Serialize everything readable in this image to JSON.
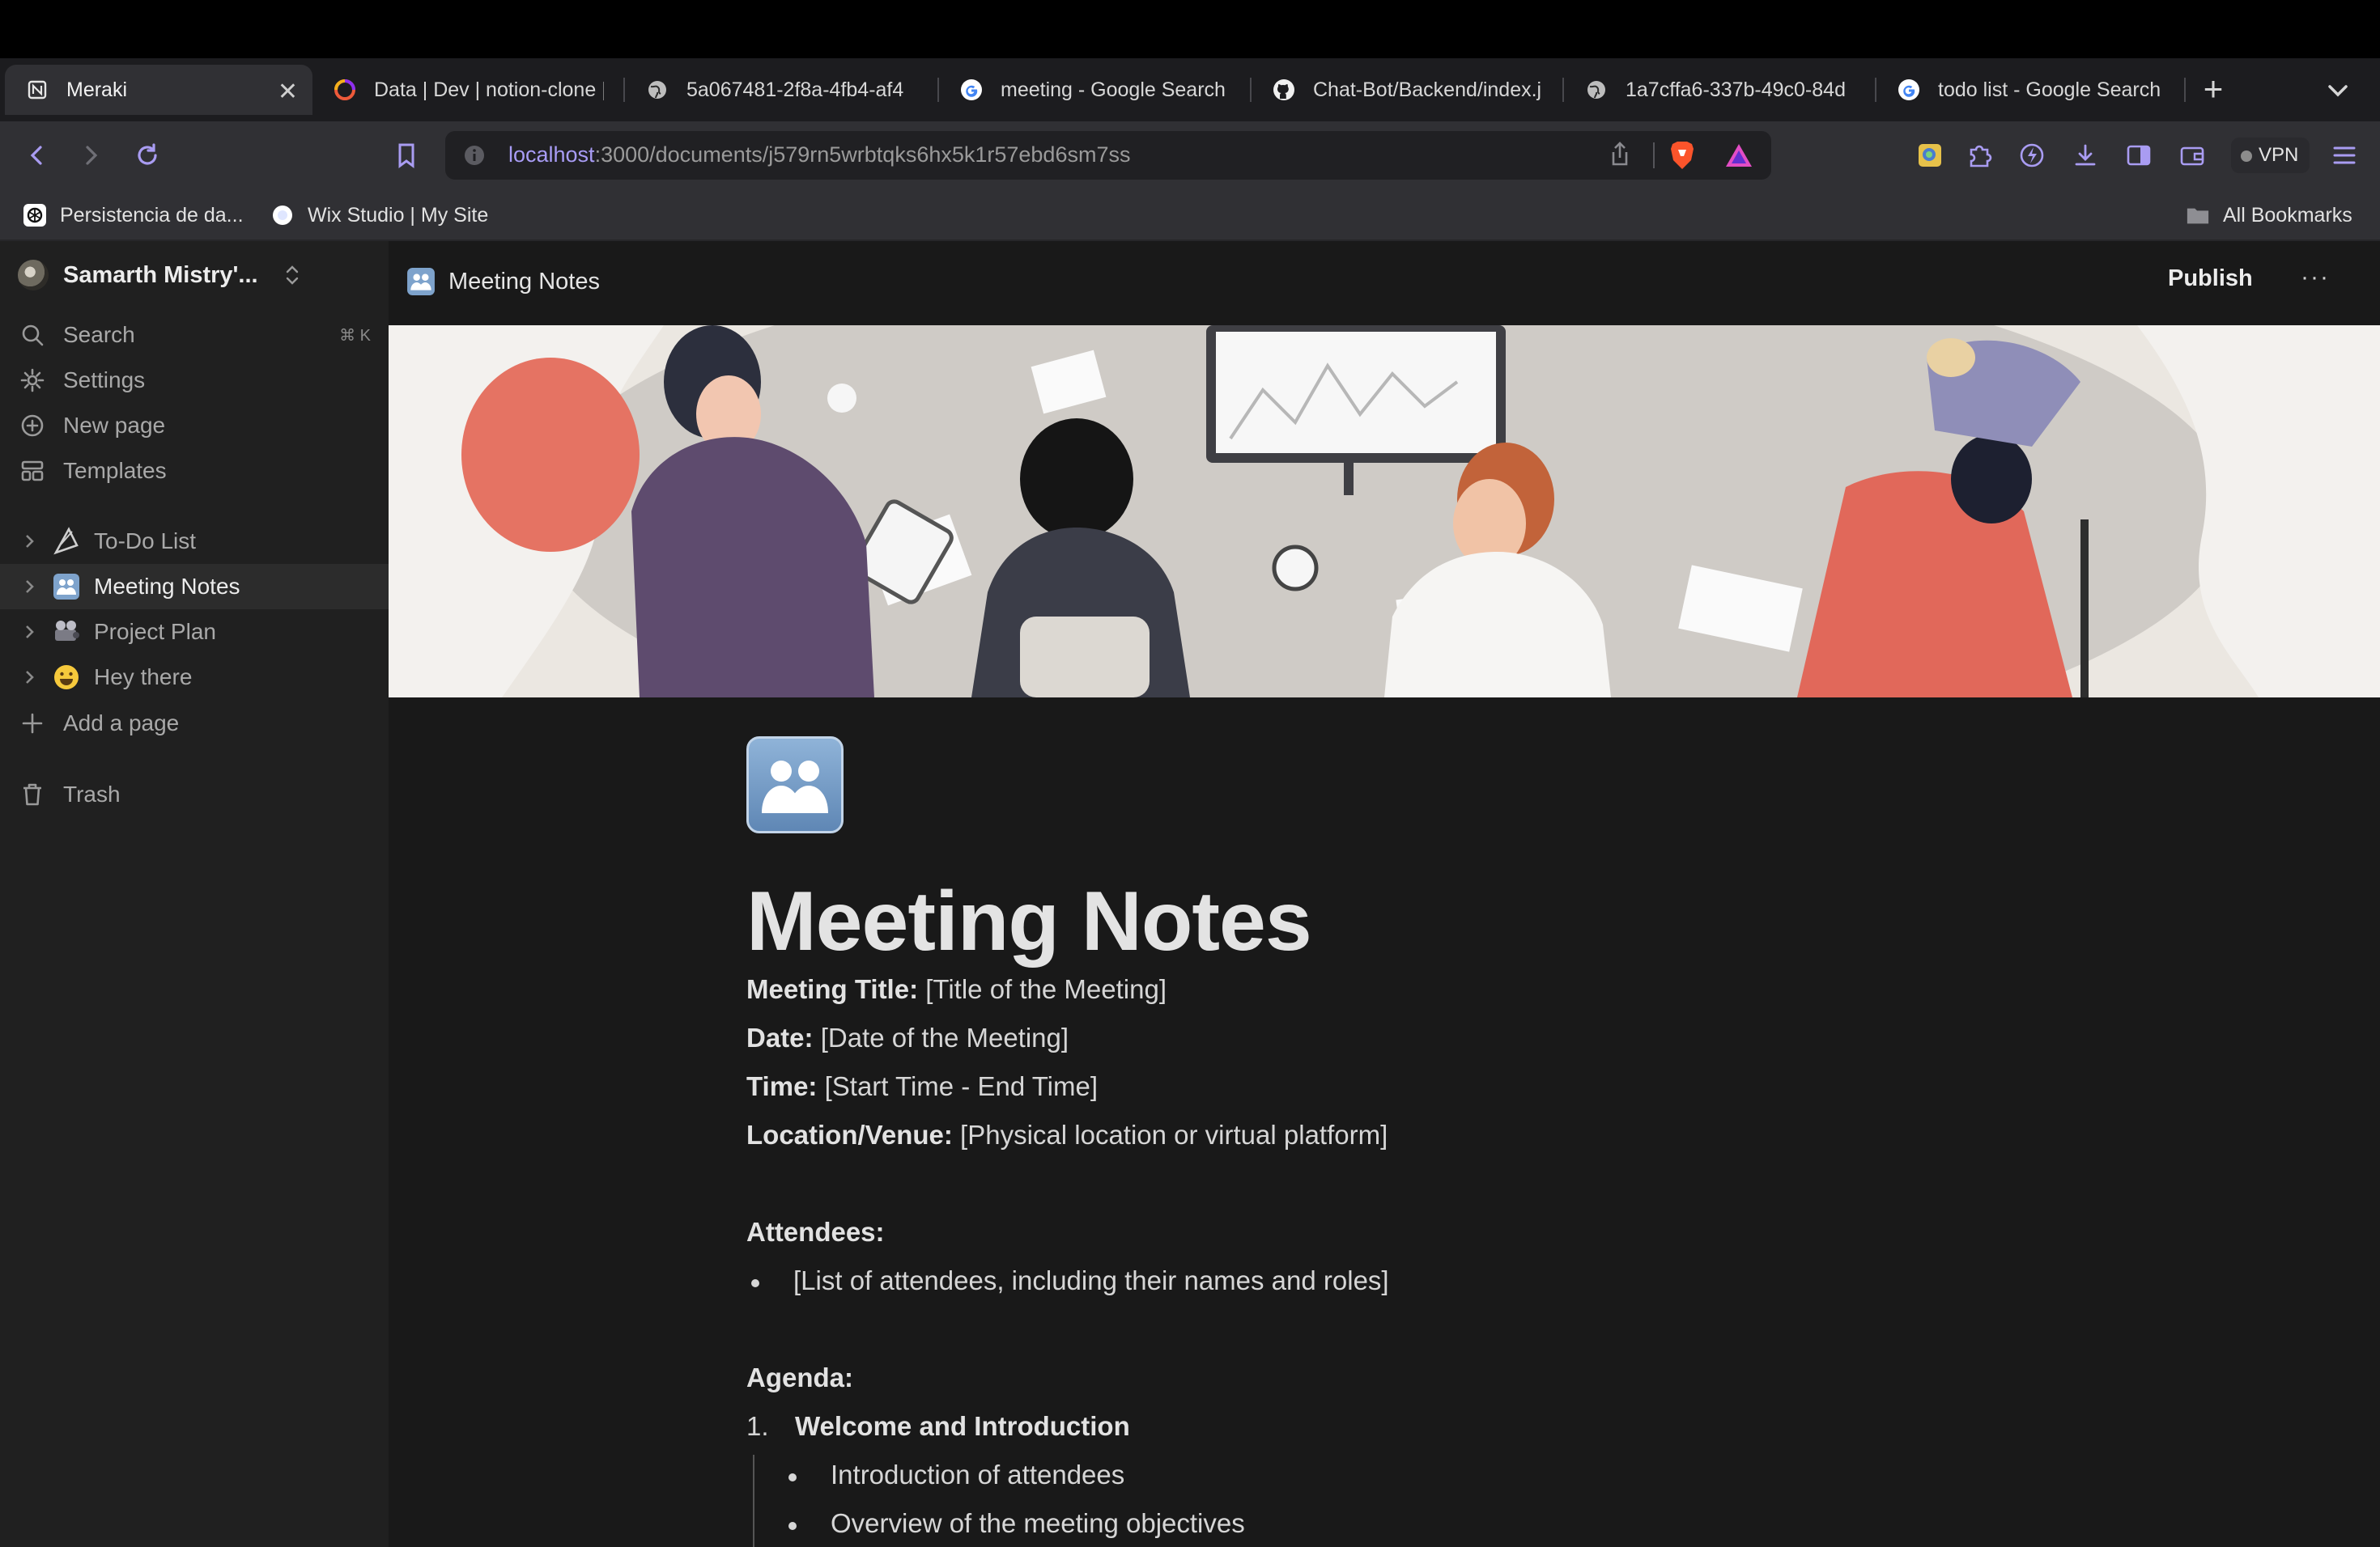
{
  "tabs": [
    {
      "title": "Meraki",
      "icon": "notion-icon",
      "active": true
    },
    {
      "title": "Data | Dev | notion-clone |",
      "icon": "convex-icon"
    },
    {
      "title": "5a067481-2f8a-4fb4-af4",
      "icon": "globe-icon"
    },
    {
      "title": "meeting - Google Search",
      "icon": "google-icon"
    },
    {
      "title": "Chat-Bot/Backend/index.j",
      "icon": "github-icon"
    },
    {
      "title": "1a7cffa6-337b-49c0-84d",
      "icon": "globe-icon"
    },
    {
      "title": "todo list - Google Search",
      "icon": "google-icon"
    }
  ],
  "tab_close": "✕",
  "new_tab": "+",
  "address": {
    "host": "localhost",
    "path": ":3000/documents/j579rn5wrbtqks6hx5k1r57ebd6sm7ss"
  },
  "vpn_label": "VPN",
  "bookmarks": {
    "items": [
      "Persistencia de da...",
      "Wix Studio | My Site"
    ],
    "all": "All Bookmarks"
  },
  "sidebar": {
    "workspace": "Samarth Mistry'...",
    "search": "Search",
    "search_shortcut": "⌘ K",
    "settings": "Settings",
    "new_page": "New page",
    "templates": "Templates",
    "pages": [
      {
        "label": "To-Do List",
        "icon": "🪁"
      },
      {
        "label": "Meeting Notes",
        "icon": "🧑‍🤝‍🧑",
        "active": true
      },
      {
        "label": "Project Plan",
        "icon": "📽"
      },
      {
        "label": "Hey there",
        "icon": "😀"
      }
    ],
    "add_page": "Add a page",
    "trash": "Trash"
  },
  "header": {
    "breadcrumb": "Meeting Notes",
    "publish": "Publish",
    "more": "···"
  },
  "document": {
    "title": "Meeting Notes",
    "fields": [
      {
        "label": "Meeting Title:",
        "value": " [Title of the Meeting]"
      },
      {
        "label": "Date:",
        "value": " [Date of the Meeting]"
      },
      {
        "label": "Time:",
        "value": " [Start Time - End Time]"
      },
      {
        "label": "Location/Venue:",
        "value": " [Physical location or virtual platform]"
      }
    ],
    "attendees_heading": "Attendees:",
    "attendees_item": "[List of attendees, including their names and roles]",
    "agenda_heading": "Agenda:",
    "agenda_number": "1.",
    "agenda_item": "Welcome and Introduction",
    "agenda_sub": [
      "Introduction of attendees",
      "Overview of the meeting objectives"
    ]
  },
  "colors": {
    "accent_url": "#a89cf5",
    "background": "#191919",
    "sidebar": "#202020"
  }
}
